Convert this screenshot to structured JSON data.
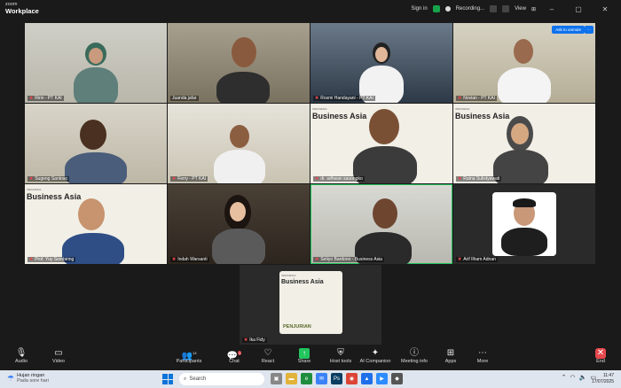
{
  "app": {
    "brand_top": "zoom",
    "brand_bottom": "Workplace"
  },
  "titlebar": {
    "signin": "Sign in",
    "recording": "Recording...",
    "view": "View"
  },
  "tiles": [
    {
      "name": "Ririn - PT KAI",
      "mic_off": true
    },
    {
      "name": "Juanda jafar",
      "mic_off": false
    },
    {
      "name": "Rosmi Handayani - PT KAI",
      "mic_off": true
    },
    {
      "name": "Novian - PT KAI",
      "mic_off": true
    },
    {
      "name": "Sugeng Santoso",
      "mic_off": true
    },
    {
      "name": "Ferry - PT KAI",
      "mic_off": true
    },
    {
      "name": "dr. adhwan sauongko",
      "mic_off": true
    },
    {
      "name": "Ratna Sulistyawati",
      "mic_off": true
    },
    {
      "name": "Prof. Yuy Sembiring",
      "mic_off": true
    },
    {
      "name": "Indah Warsanti",
      "mic_off": true
    },
    {
      "name": "Setiyo Bardono - Business Asia",
      "mic_off": true
    },
    {
      "name": "Arif Ilham Adnan",
      "mic_off": true
    },
    {
      "name": "Ika Fidy",
      "mic_off": true
    }
  ],
  "overlay": {
    "ask_unmute": "Ask to unmute",
    "more": "···"
  },
  "business_asia": {
    "small": "INDONESIA",
    "big": "Business Asia",
    "penjurian": "PENJURIAN"
  },
  "toolbar": {
    "audio": "Audio",
    "video": "Video",
    "participants": "Participants",
    "participants_count": "13",
    "chat": "Chat",
    "chat_badge": "1",
    "react": "React",
    "share": "Share",
    "host_tools": "Host tools",
    "ai_companion": "AI Companion",
    "meeting_info": "Meeting info",
    "apps": "Apps",
    "more": "More",
    "end": "End"
  },
  "taskbar": {
    "weather_title": "Hujan ringan",
    "weather_sub": "Pada sore hari",
    "search": "Search",
    "time": "11:47",
    "date": "17/07/2025"
  },
  "colors": {
    "accent": "#0e72ed",
    "active_speaker": "#22c55e",
    "end": "#e5484d"
  }
}
